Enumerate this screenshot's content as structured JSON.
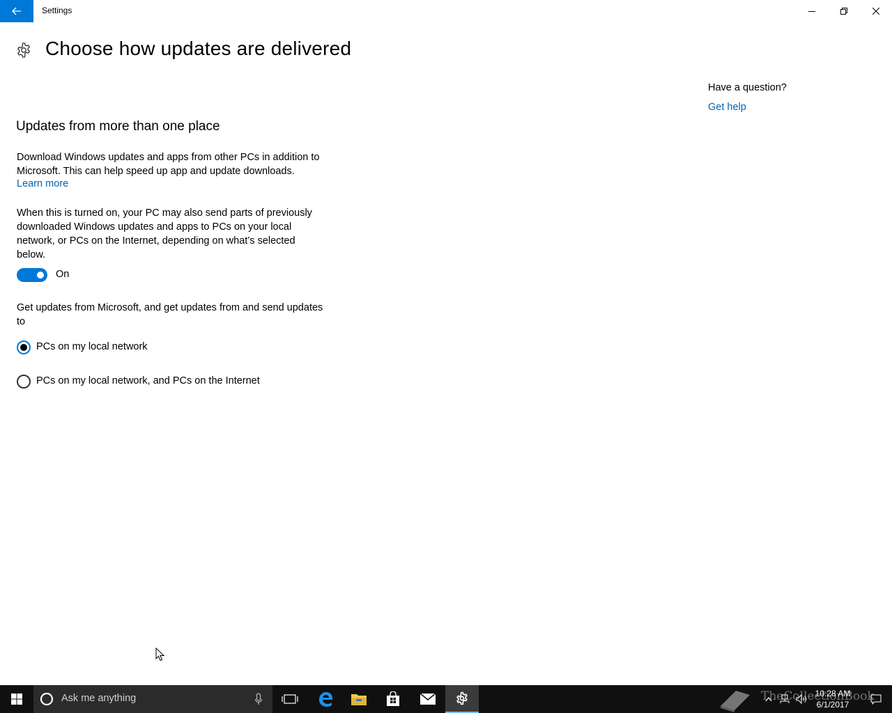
{
  "window": {
    "title": "Settings"
  },
  "page": {
    "title": "Choose how updates are delivered"
  },
  "section": {
    "title": "Updates from more than one place",
    "description": "Download Windows updates and apps from other PCs in addition to Microsoft. This can help speed up app and update downloads.",
    "learn_more": "Learn more",
    "toggle_description": "When this is turned on, your PC may also send parts of previously downloaded Windows updates and apps to PCs on your local network, or PCs on the Internet, depending on what’s selected below.",
    "toggle_state": "On",
    "radio_intro": "Get updates from Microsoft, and get updates from and send updates to",
    "options": [
      {
        "label": "PCs on my local network",
        "selected": true
      },
      {
        "label": "PCs on my local network, and PCs on the Internet",
        "selected": false
      }
    ]
  },
  "help": {
    "question": "Have a question?",
    "link": "Get help"
  },
  "taskbar": {
    "search_placeholder": "Ask me anything",
    "clock_time": "10:28 AM",
    "clock_date": "6/1/2017",
    "watermark": "TheCollectionBook",
    "apps": [
      "task-view",
      "edge",
      "file-explorer",
      "store",
      "mail",
      "settings"
    ],
    "active_app": "settings"
  },
  "colors": {
    "accent": "#0078d7",
    "link": "#0063b1",
    "taskbar": "#101010",
    "search_box": "#2b2b2b"
  }
}
